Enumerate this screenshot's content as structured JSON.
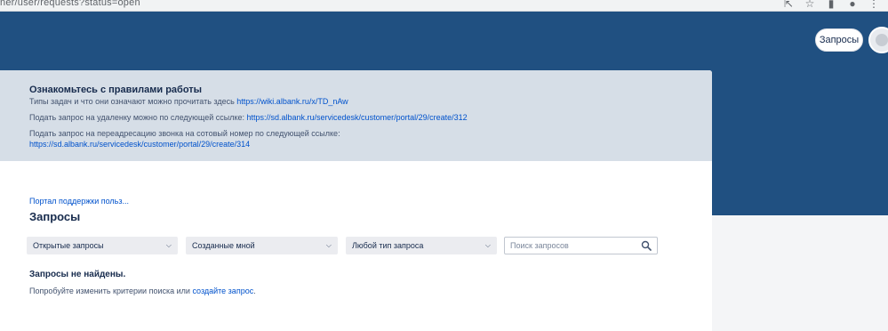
{
  "browser": {
    "url": "ner/user/requests?status=open",
    "icons": [
      "share-icon",
      "star-icon",
      "sidebar-icon",
      "profile-icon",
      "menu-icon"
    ]
  },
  "header": {
    "requests_button": "Запросы"
  },
  "notice": {
    "title": "Ознакомьтесь с правилами работы",
    "line1_text": "Типы задач и что они означают можно прочитать здесь ",
    "line1_link": "https://wiki.albank.ru/x/TD_nAw",
    "line2_text": "Подать запрос на удаленку можно по следующей ссылке: ",
    "line2_link": "https://sd.albank.ru/servicedesk/customer/portal/29/create/312",
    "line3_text": "Подать запрос на переадресацию звонка на сотовый номер по следующей ссылке:",
    "line3_link": "https://sd.albank.ru/servicedesk/customer/portal/29/create/314"
  },
  "main": {
    "breadcrumb": "Портал поддержки польз...",
    "title": "Запросы",
    "filters": [
      {
        "label": "Открытые запросы"
      },
      {
        "label": "Созданные мной"
      },
      {
        "label": "Любой тип запроса"
      }
    ],
    "search_placeholder": "Поиск запросов",
    "empty_title": "Запросы не найдены.",
    "empty_text_before": "Попробуйте изменить критерии поиска или ",
    "empty_link": "создайте запрос",
    "empty_text_after": "."
  },
  "colors": {
    "banner": "#205081",
    "notice_bg": "#d6dee7",
    "link": "#0052cc"
  }
}
